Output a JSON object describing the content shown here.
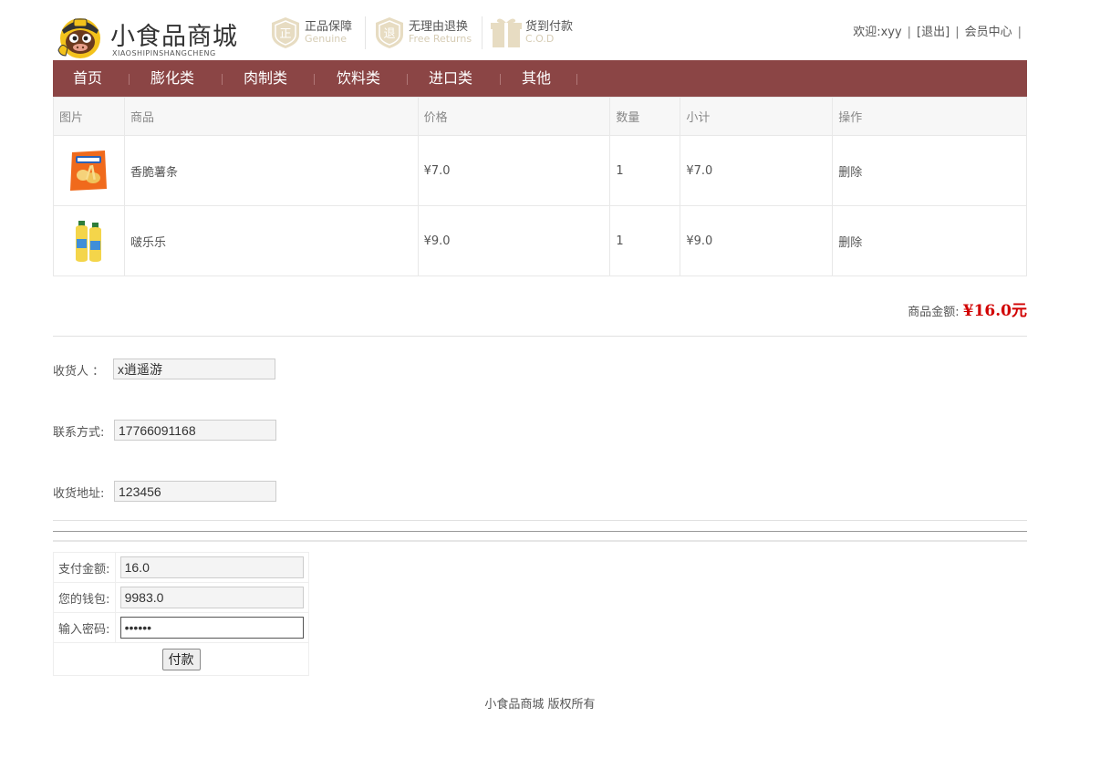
{
  "header": {
    "logo_title": "小食品商城",
    "logo_sub": "XIAOSHIPINSHANGCHENG",
    "badges": [
      {
        "title": "正品保障",
        "sub": "Genuine",
        "icon": "genuine-shield-icon"
      },
      {
        "title": "无理由退换",
        "sub": "Free Returns",
        "icon": "returns-shield-icon"
      },
      {
        "title": "货到付款",
        "sub": "C.O.D",
        "icon": "cod-gift-icon"
      }
    ],
    "user": {
      "welcome": "欢迎:xyy",
      "logout": "[退出]",
      "member": "会员中心",
      "sep": "|"
    }
  },
  "nav": [
    "首页",
    "膨化类",
    "肉制类",
    "饮料类",
    "进口类",
    "其他"
  ],
  "cart": {
    "headers": [
      "图片",
      "商品",
      "价格",
      "数量",
      "小计",
      "操作"
    ],
    "rows": [
      {
        "name": "香脆薯条",
        "price": "¥7.0",
        "qty": "1",
        "subtotal": "¥7.0",
        "action": "删除"
      },
      {
        "name": "啵乐乐",
        "price": "¥9.0",
        "qty": "1",
        "subtotal": "¥9.0",
        "action": "删除"
      }
    ],
    "total_label": "商品金额:",
    "total_value": "¥16.0元"
  },
  "shipping": {
    "recipient_label": "收货人 ：",
    "recipient_value": "x逍遥游",
    "phone_label": "联系方式:",
    "phone_value": "17766091168",
    "address_label": "收货地址:",
    "address_value": "123456"
  },
  "payment": {
    "amount_label": "支付金额:",
    "amount_value": "16.0",
    "wallet_label": "您的钱包:",
    "wallet_value": "9983.0",
    "password_label": "输入密码:",
    "password_value": "123456",
    "pay_button": "付款"
  },
  "footer": "小食品商城 版权所有",
  "colors": {
    "nav_bg": "#8b4545",
    "price_red": "#d10000"
  }
}
